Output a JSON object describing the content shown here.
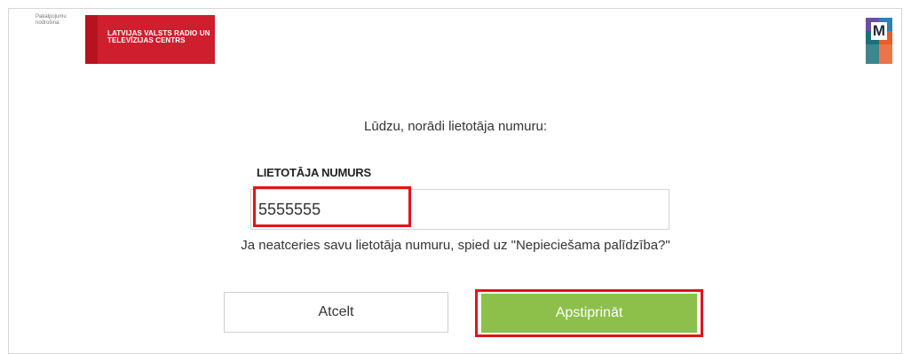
{
  "header": {
    "provider_caption": "Pakalpojumu nodrošina:",
    "provider_logo_text": "LATVIJAS VALSTS RADIO UN TELEVĪZIJAS CENTRS",
    "brand_logo_letter": "M"
  },
  "form": {
    "prompt": "Lūdzu, norādi lietotāja numuru:",
    "field_label": "LIETOTĀJA NUMURS",
    "user_number_value": "5555555",
    "help_text": "Ja neatceries savu lietotāja numuru, spied uz \"Nepieciešama palīdzība?\""
  },
  "buttons": {
    "cancel_label": "Atcelt",
    "confirm_label": "Apstiprināt"
  },
  "colors": {
    "confirm_button": "#8cc04a",
    "highlight": "#e3131a",
    "provider_logo": "#cf1e2e"
  }
}
